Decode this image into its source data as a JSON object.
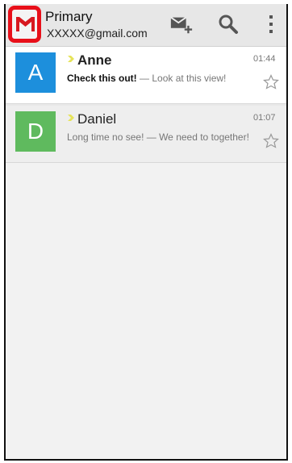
{
  "account": {
    "title": "Primary",
    "email": "XXXXX@gmail.com"
  },
  "icons": {
    "app": "gmail-logo-icon",
    "compose": "compose-mail-icon",
    "search": "search-icon",
    "menu": "overflow-menu-icon",
    "importance": "importance-marker-icon",
    "star": "star-outline-icon"
  },
  "colors": {
    "highlight": "#e8101a",
    "importance_marker": "#e6e35a",
    "avatar_anne": "#1d8fdc",
    "avatar_daniel": "#5fba5e"
  },
  "messages": [
    {
      "avatar_letter": "A",
      "sender": "Anne",
      "subject": "Check this out!",
      "snippet": " — Look at this view!",
      "time": "01:44",
      "unread": true
    },
    {
      "avatar_letter": "D",
      "sender": "Daniel",
      "subject": "Long time no see!",
      "snippet": " — We need to together!",
      "time": "01:07",
      "unread": false
    }
  ]
}
